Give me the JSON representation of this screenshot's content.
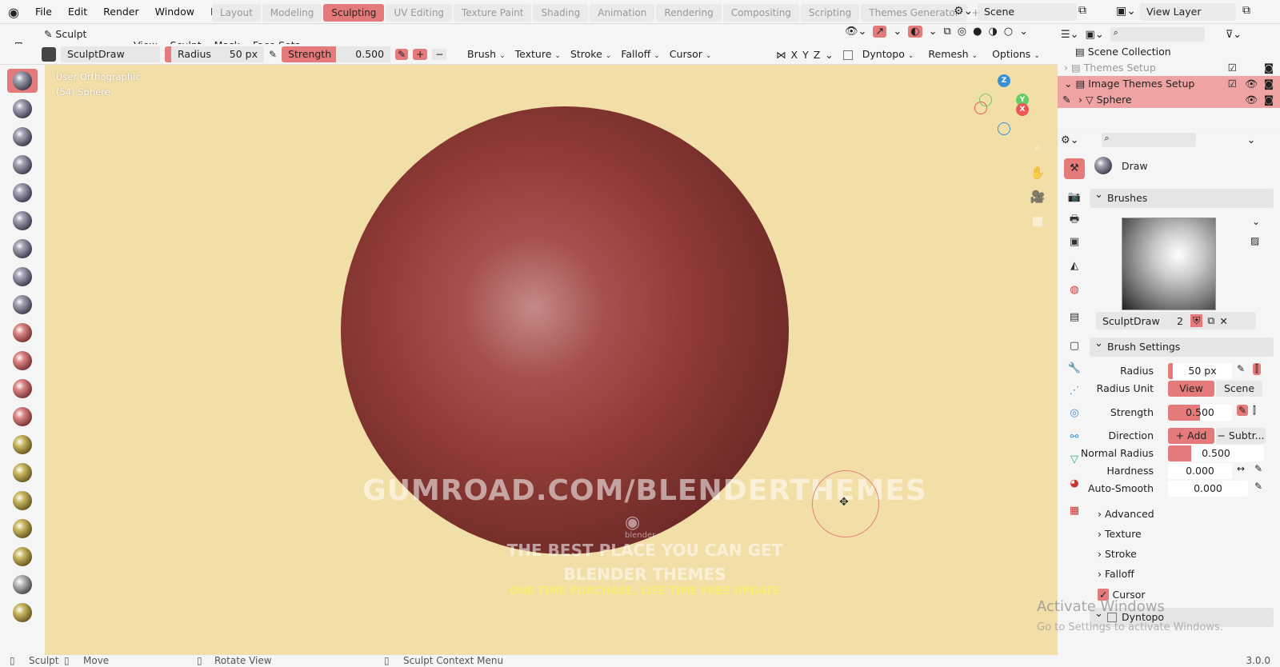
{
  "menubar": {
    "items": [
      "File",
      "Edit",
      "Render",
      "Window",
      "Help"
    ],
    "workspaces": [
      "Layout",
      "Modeling",
      "Sculpting",
      "UV Editing",
      "Texture Paint",
      "Shading",
      "Animation",
      "Rendering",
      "Compositing",
      "Scripting",
      "Themes Generator"
    ],
    "active_workspace": "Sculpting",
    "scene": "Scene",
    "view_layer": "View Layer"
  },
  "header": {
    "mode": "Sculpt Mode",
    "menus": [
      "View",
      "Sculpt",
      "Mask",
      "Face Sets"
    ]
  },
  "tool_settings": {
    "brush_name": "SculptDraw",
    "radius_label": "Radius",
    "radius_value": "50 px",
    "strength_label": "Strength",
    "strength_value": "0.500",
    "menus": [
      "Brush",
      "Texture",
      "Stroke",
      "Falloff",
      "Cursor"
    ],
    "axes": [
      "X",
      "Y",
      "Z"
    ],
    "right_menus": [
      "Dyntopo",
      "Remesh",
      "Options"
    ]
  },
  "viewport": {
    "view_name": "User Orthographic",
    "object_info": "(54) Sphere",
    "watermark_main": "GUMROAD.COM/BLENDERTHEMES",
    "watermark_sub1": "THE BEST PLACE YOU CAN GET",
    "watermark_sub2": "BLENDER THEMES",
    "watermark_sub3": "ONE TIME PURCHASE, LIFE TIME FREE UPDATE",
    "gizmo_axes": [
      "Z",
      "Y",
      "X"
    ],
    "blender_logo_text": "blender"
  },
  "outliner": {
    "rows": [
      {
        "label": "Scene Collection",
        "selected": false
      },
      {
        "label": "Themes Setup",
        "selected": false
      },
      {
        "label": "Image Themes Setup",
        "selected": true
      },
      {
        "label": "Sphere",
        "selected": true
      }
    ]
  },
  "properties": {
    "tool_name": "Draw",
    "brushes_header": "Brushes",
    "brush_datablock": "SculptDraw",
    "brush_users": "2",
    "brush_settings_header": "Brush Settings",
    "fields": {
      "radius_label": "Radius",
      "radius_value": "50 px",
      "radius_unit_label": "Radius Unit",
      "radius_unit_view": "View",
      "radius_unit_scene": "Scene",
      "strength_label": "Strength",
      "strength_value": "0.500",
      "direction_label": "Direction",
      "direction_add": "Add",
      "direction_sub": "Subtr...",
      "normal_radius_label": "Normal Radius",
      "normal_radius_value": "0.500",
      "hardness_label": "Hardness",
      "hardness_value": "0.000",
      "autosmooth_label": "Auto-Smooth",
      "autosmooth_value": "0.000"
    },
    "subpanels": [
      "Advanced",
      "Texture",
      "Stroke",
      "Falloff"
    ],
    "cursor_label": "Cursor",
    "dyntopo_label": "Dyntopo"
  },
  "statusbar": {
    "sculpt": "Sculpt",
    "move": "Move",
    "rotate": "Rotate View",
    "context_menu": "Sculpt Context Menu",
    "version": "3.0.0"
  },
  "activation": {
    "line1": "Activate Windows",
    "line2": "Go to Settings to activate Windows."
  },
  "colors": {
    "accent": "#e47a7a",
    "viewport_bg": "#f2dfa8",
    "sphere": "#8e3b34"
  }
}
